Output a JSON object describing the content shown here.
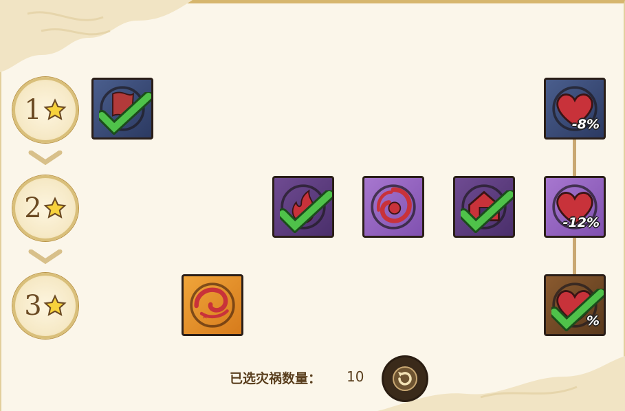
{
  "tiers": [
    {
      "number": "1",
      "star": "star-icon"
    },
    {
      "number": "2",
      "star": "star-icon"
    },
    {
      "number": "3",
      "star": "star-icon"
    }
  ],
  "tiles": {
    "t1_flag": {
      "icon": "flag-icon",
      "selected": true
    },
    "t1_heart": {
      "icon": "heart-icon",
      "label": "-8%"
    },
    "t2_fire": {
      "icon": "fire-icon",
      "selected": true
    },
    "t2_spiral": {
      "icon": "spiral-icon"
    },
    "t2_house": {
      "icon": "house-icon",
      "selected": true
    },
    "t2_heart": {
      "icon": "heart-icon",
      "label": "-12%"
    },
    "t3_swirl": {
      "icon": "swirl-icon"
    },
    "t3_heart": {
      "icon": "heart-icon",
      "label": "%",
      "selected": true
    }
  },
  "footer": {
    "label": "已选灾祸数量：",
    "count": "10"
  },
  "colors": {
    "check": "#4fc24a",
    "badge_ring": "#d9bf7a",
    "text": "#5a3f1e"
  }
}
